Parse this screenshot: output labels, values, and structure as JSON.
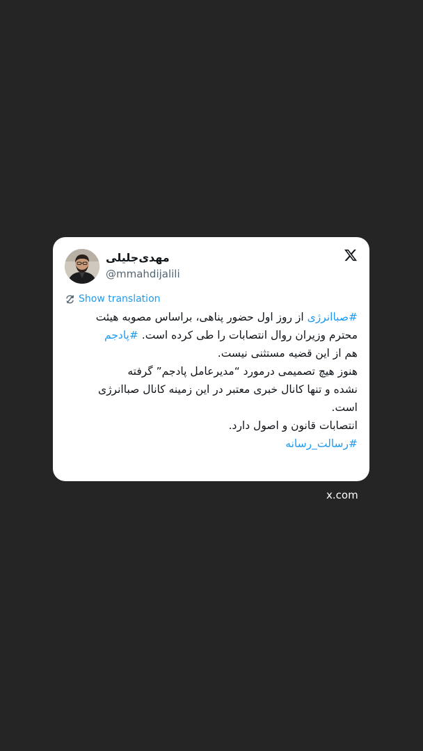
{
  "colors": {
    "background": "#252525",
    "card": "#ffffff",
    "link": "#1d9bf0",
    "text": "#0f1419",
    "muted": "#536471"
  },
  "tweet": {
    "author_name": "مهدی‌جلیلی",
    "author_handle": "@mmahdijalili",
    "platform_icon": "x-logo-icon",
    "translate_icon": "translate-refresh-icon",
    "translate_label": "Show translation",
    "lines": [
      {
        "hashtag": "#صباانرژی",
        "text": " از روز اول حضور پناهی، براساس مصوبه هیئت"
      },
      {
        "text": "محترم وزیران روال انتصابات را طی کرده است. ",
        "hashtag": "#پادجم"
      },
      {
        "text": "هم از این قضیه مستثنی نیست."
      },
      {
        "text": "هنوز هیچ تصمیمی درمورد “مدیرعامل پادجم” گرفته"
      },
      {
        "text": "نشده و تنها کانال خبری معتبر در این زمینه کانال صباانرژی"
      },
      {
        "text": "است."
      },
      {
        "text": "انتصابات قانون و اصول دارد."
      },
      {
        "hashtag": "#رسالت_رسانه"
      }
    ]
  },
  "source_label": "x.com"
}
